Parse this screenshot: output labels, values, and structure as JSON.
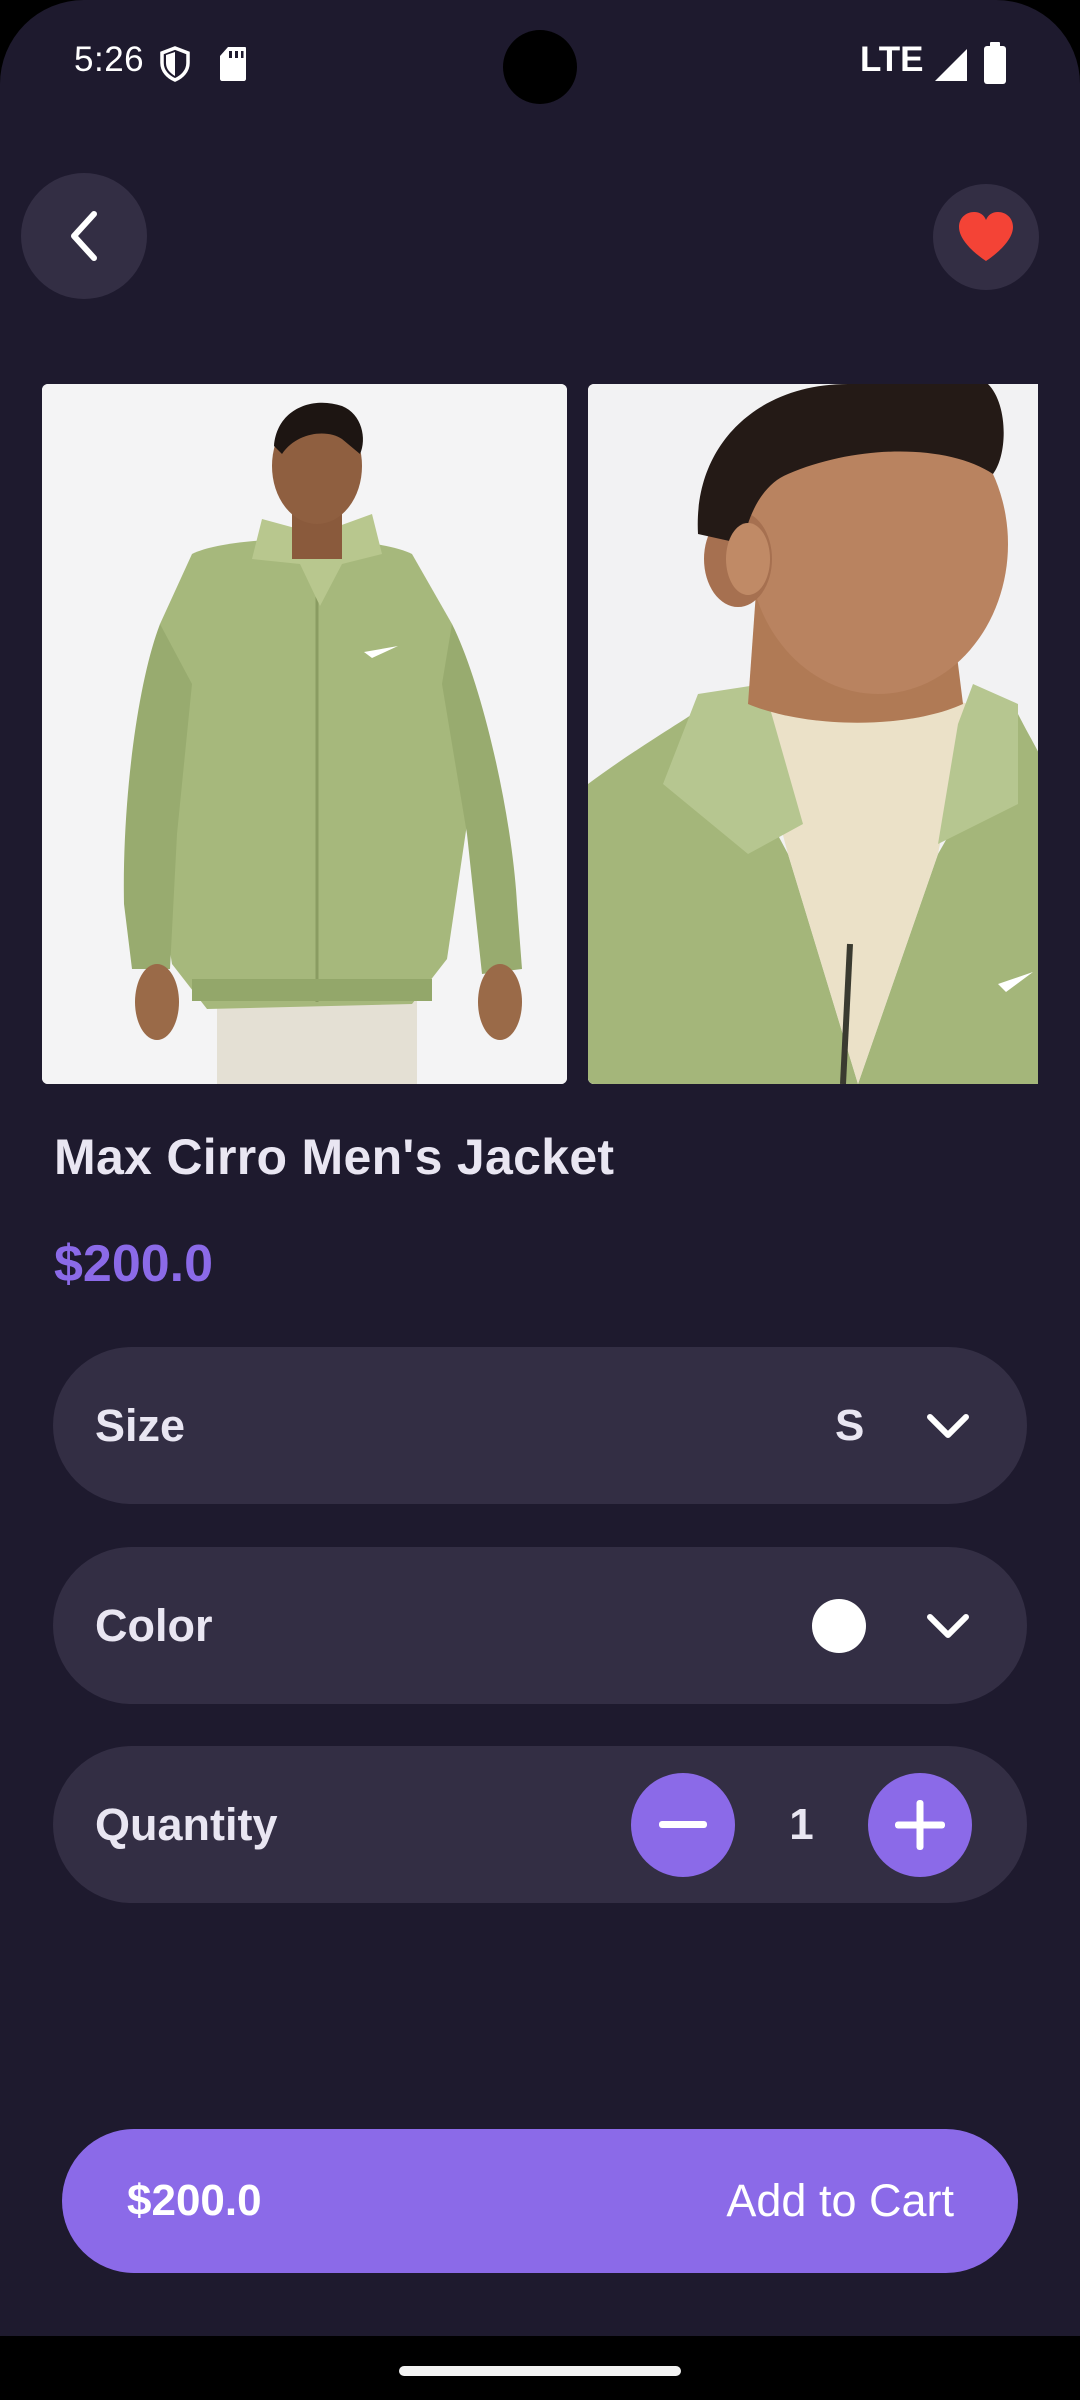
{
  "status_bar": {
    "time": "5:26",
    "network": "LTE"
  },
  "header": {
    "back_icon": "chevron-left-icon",
    "favorite_icon": "heart-icon",
    "favorite_color": "#f44336"
  },
  "gallery": {
    "images": [
      "jacket-front-photo",
      "jacket-collar-closeup-photo"
    ]
  },
  "product": {
    "title": "Max Cirro Men's Jacket",
    "price": "$200.0"
  },
  "options": {
    "size_label": "Size",
    "size_value": "S",
    "color_label": "Color",
    "color_value": "#ffffff",
    "quantity_label": "Quantity",
    "quantity_value": "1"
  },
  "cart": {
    "price": "$200.0",
    "label": "Add to Cart"
  },
  "colors": {
    "background": "#1e1a2e",
    "surface": "#332e44",
    "accent": "#8b6ae8"
  }
}
